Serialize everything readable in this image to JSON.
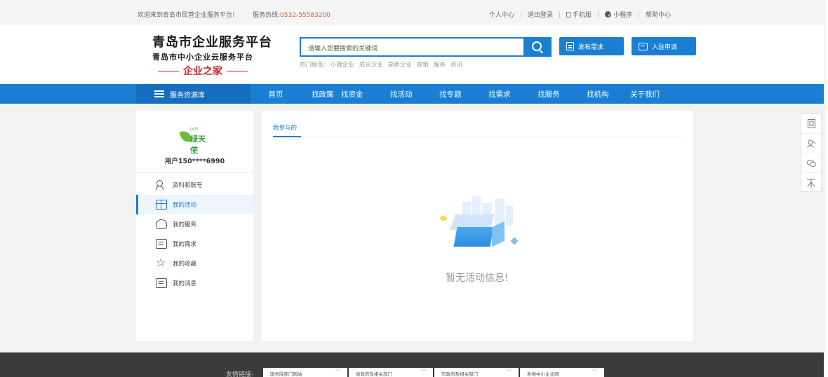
{
  "topbar": {
    "welcome": "欢迎来到青岛市民营企业服务平台!",
    "hotline_label": "服务热线:",
    "hotline_number": "0532-55583200",
    "links": [
      {
        "label": "个人中心",
        "icon": ""
      },
      {
        "label": "退出登录",
        "icon": ""
      },
      {
        "label": "手机版",
        "icon": "phone-icon"
      },
      {
        "label": "小程序",
        "icon": "miniprogram-icon"
      },
      {
        "label": "帮助中心",
        "icon": ""
      }
    ]
  },
  "header": {
    "logo_line1": "青岛市企业服务平台",
    "logo_line2": "青岛市中小企业云服务平台",
    "logo_line3": "企业之家",
    "search_placeholder": "请输入您要搜索的关键词",
    "hot_label": "热门标签:",
    "hot_tags": [
      "小微企业",
      "成长企业",
      "高新企业",
      "政策",
      "服务",
      "资讯"
    ],
    "publish_button": "发布需求",
    "join_button": "入驻申请",
    "accent_color": "#1a7fd4"
  },
  "nav": {
    "category": "服务资源库",
    "items": [
      "首页",
      "找政策",
      "找资金",
      "找活动",
      "找专题",
      "找需求",
      "找服务",
      "找机构",
      "关于我们"
    ]
  },
  "sidebar": {
    "brand_small": "LVTS",
    "brand_name": "绿天使",
    "username": "用户150****6990",
    "menu": [
      {
        "label": "资料和账号",
        "icon": "user-icon",
        "active": false
      },
      {
        "label": "我的活动",
        "icon": "gift-icon",
        "active": true
      },
      {
        "label": "我的服务",
        "icon": "service-icon",
        "active": false
      },
      {
        "label": "我的需求",
        "icon": "requirement-icon",
        "active": false
      },
      {
        "label": "我的收藏",
        "icon": "star-icon",
        "active": false
      },
      {
        "label": "我的消息",
        "icon": "message-icon",
        "active": false
      }
    ]
  },
  "main": {
    "tab": "我参与的",
    "empty_text": "暂无活动信息!"
  },
  "floatbar": {
    "items": [
      "document-icon",
      "user-service-icon",
      "wechat-icon",
      "back-to-top-icon"
    ]
  },
  "footer": {
    "label": "友情链接:",
    "selects": [
      "国务院部门网站",
      "省政府及相关部门",
      "市政府及相关部门",
      "各地中小企业网"
    ]
  }
}
